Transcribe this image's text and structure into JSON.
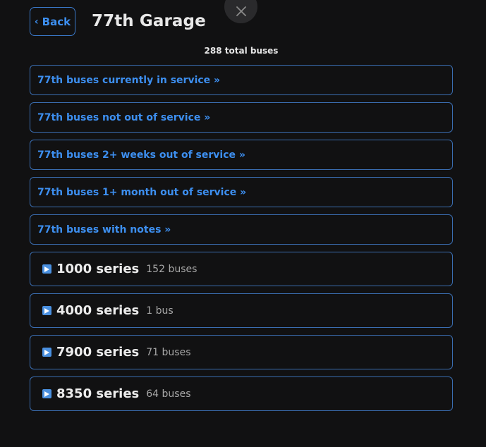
{
  "header": {
    "back_chevron": "‹",
    "back_label": "Back",
    "title": "77th Garage",
    "close_icon": "close-icon"
  },
  "summary": {
    "total": "288 total buses"
  },
  "links": [
    {
      "label": "77th buses currently in service »"
    },
    {
      "label": "77th buses not out of service »"
    },
    {
      "label": "77th buses 2+ weeks out of service »"
    },
    {
      "label": "77th buses 1+ month out of service »"
    },
    {
      "label": "77th buses with notes »"
    }
  ],
  "series": [
    {
      "name": "1000 series",
      "count": "152 buses"
    },
    {
      "name": "4000 series",
      "count": "1 bus"
    },
    {
      "name": "7900 series",
      "count": "71 buses"
    },
    {
      "name": "8350 series",
      "count": "64 buses"
    }
  ],
  "colors": {
    "background": "#111112",
    "accent": "#3d8ff0",
    "border": "#3a6db0"
  }
}
